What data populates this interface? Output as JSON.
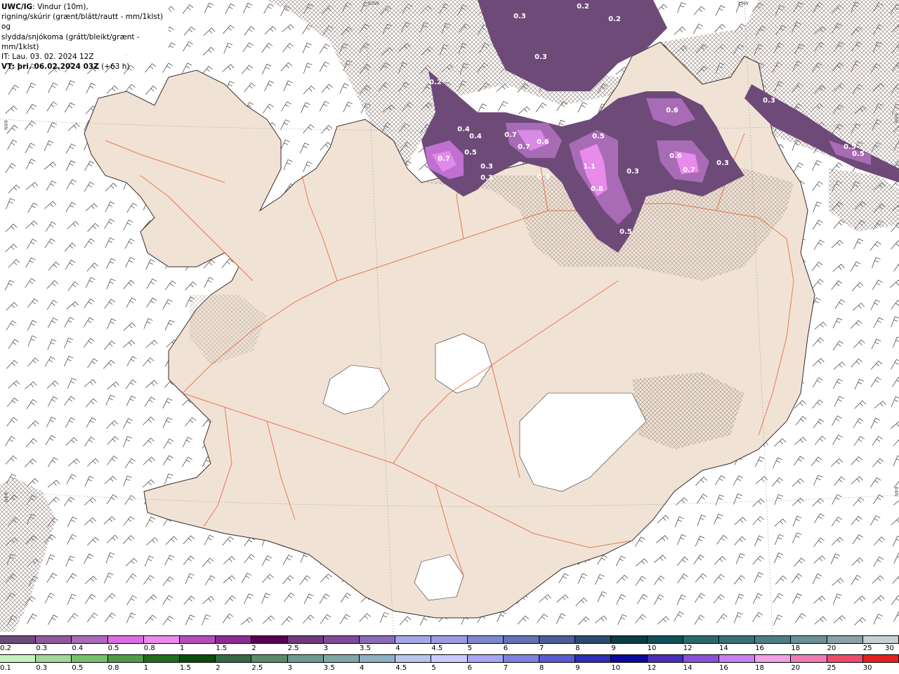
{
  "header": {
    "model": "UWC/IG",
    "line1_rest": ": Vindur (10m),",
    "line2": "rigning/skúrir (grænt/blátt/rautt - mm/1klst) og",
    "line3": "slydda/snjókoma (grátt/bleikt/grænt - mm/1klst)",
    "line4": "IT: Lau. 03. 02. 2024 12Z",
    "vt_label": "VT: þri. 06.02.2024 03Z",
    "vt_offset": " (+63 h)"
  },
  "coord_labels": {
    "top_left": "20W",
    "top_right": "15W",
    "left_upper": "66N",
    "left_lower": "64N",
    "right_upper": "66N",
    "right_lower": "64N"
  },
  "precip_labels": [
    "0.2",
    "0.2",
    "0.3",
    "0.3",
    "0.2",
    "0.4",
    "0.4",
    "0.5",
    "0.7",
    "0.3",
    "0.3",
    "0.7",
    "0.7",
    "0.6",
    "0.3",
    "0.5",
    "1.1",
    "0.8",
    "0.5",
    "0.3",
    "0.6",
    "0.6",
    "0.7",
    "0.3",
    "0.3",
    "0.5",
    "0.5"
  ],
  "colorbar_top": {
    "colors": [
      "#6e4a78",
      "#8e5a9a",
      "#a86bb5",
      "#d96ee0",
      "#e88bea",
      "#b150b8",
      "#8a2e8f",
      "#560050",
      "#6e3a7a",
      "#7c4c94",
      "#8a6cb2",
      "#a7a7e6",
      "#9b9bde",
      "#7f86cc",
      "#6274b2",
      "#4a5f98",
      "#2d4a6e",
      "#0d3b48",
      "#134e5a",
      "#2d6670",
      "#3b6f76",
      "#4d7e85",
      "#6a8f95",
      "#8ca2a6",
      "#c6d0d2"
    ],
    "labels": [
      "0.2",
      "0.3",
      "0.4",
      "0.5",
      "0.8",
      "1",
      "1.5",
      "2",
      "2.5",
      "3",
      "3.5",
      "4",
      "4.5",
      "5",
      "6",
      "7",
      "8",
      "9",
      "10",
      "12",
      "14",
      "16",
      "18",
      "20",
      "25",
      "30"
    ]
  },
  "colorbar_bottom": {
    "colors": [
      "#c8f0c0",
      "#a0d898",
      "#76c06c",
      "#4e9c48",
      "#1e6e1e",
      "#0a4c0a",
      "#346a44",
      "#5a8a6a",
      "#6e9a90",
      "#7fa6a8",
      "#8fb0c2",
      "#b6c6ec",
      "#c8ccff",
      "#a6a6f2",
      "#8080e0",
      "#5a5ad2",
      "#2e2eb8",
      "#0a0a9e",
      "#4a2eb8",
      "#8a50d8",
      "#c880f0",
      "#f0a0e8",
      "#f07ab4",
      "#f04a6a",
      "#e81e1e"
    ],
    "labels": [
      "0.1",
      "0.3",
      "0.5",
      "0.8",
      "1",
      "1.5",
      "2",
      "2.5",
      "3",
      "3.5",
      "4",
      "4.5",
      "5",
      "6",
      "7",
      "8",
      "9",
      "10",
      "12",
      "14",
      "16",
      "18",
      "20",
      "25",
      "30"
    ]
  }
}
